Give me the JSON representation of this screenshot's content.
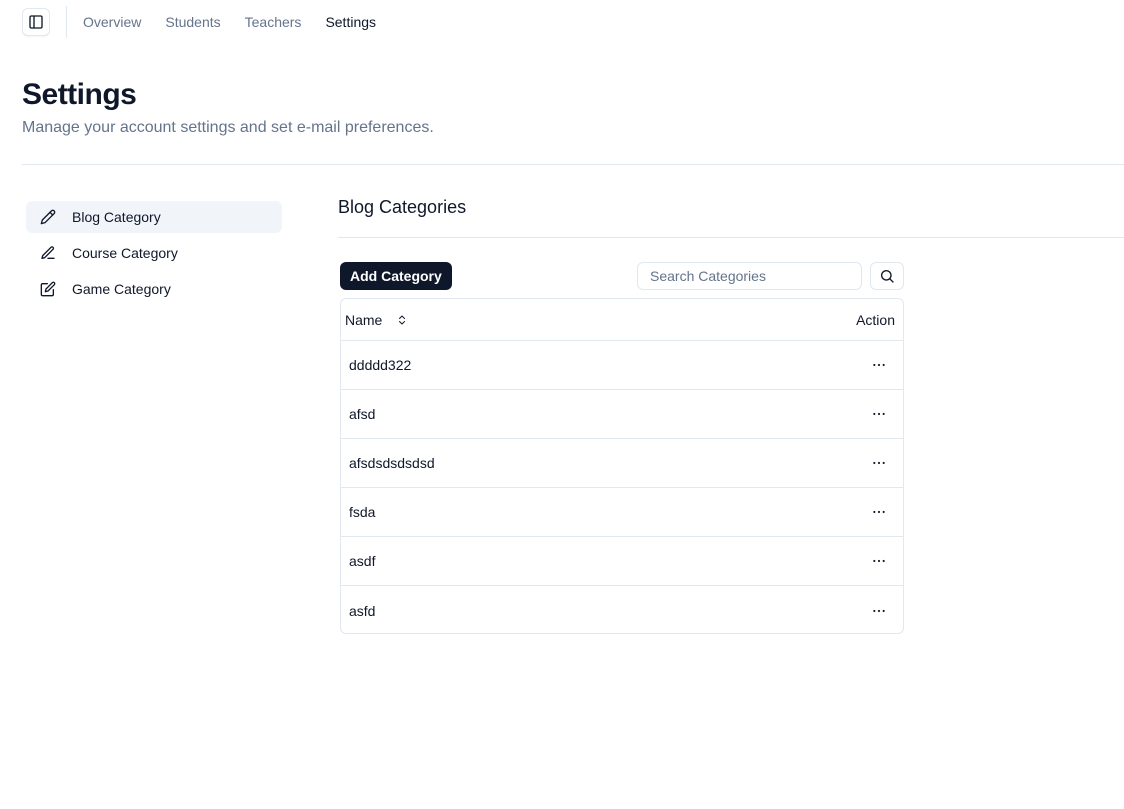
{
  "topnav": {
    "items": [
      {
        "label": "Overview",
        "active": false
      },
      {
        "label": "Students",
        "active": false
      },
      {
        "label": "Teachers",
        "active": false
      },
      {
        "label": "Settings",
        "active": true
      }
    ]
  },
  "page": {
    "title": "Settings",
    "subtitle": "Manage your account settings and set e-mail preferences."
  },
  "sidebar": {
    "items": [
      {
        "label": "Blog Category",
        "icon": "pencil-icon",
        "active": true
      },
      {
        "label": "Course Category",
        "icon": "pen-line-icon",
        "active": false
      },
      {
        "label": "Game Category",
        "icon": "edit-square-icon",
        "active": false
      }
    ]
  },
  "section": {
    "title": "Blog Categories",
    "add_button": "Add Category",
    "search_placeholder": "Search Categories"
  },
  "table": {
    "columns": {
      "name": "Name",
      "action": "Action"
    },
    "rows": [
      {
        "name": "ddddd322"
      },
      {
        "name": "afsd"
      },
      {
        "name": "afsdsdsdsdsd"
      },
      {
        "name": "fsda"
      },
      {
        "name": "asdf"
      },
      {
        "name": "asfd"
      }
    ]
  },
  "colors": {
    "primary": "#0f172a",
    "muted": "#64748b",
    "border": "#e2e8f0",
    "active_bg": "#f1f5f9"
  }
}
